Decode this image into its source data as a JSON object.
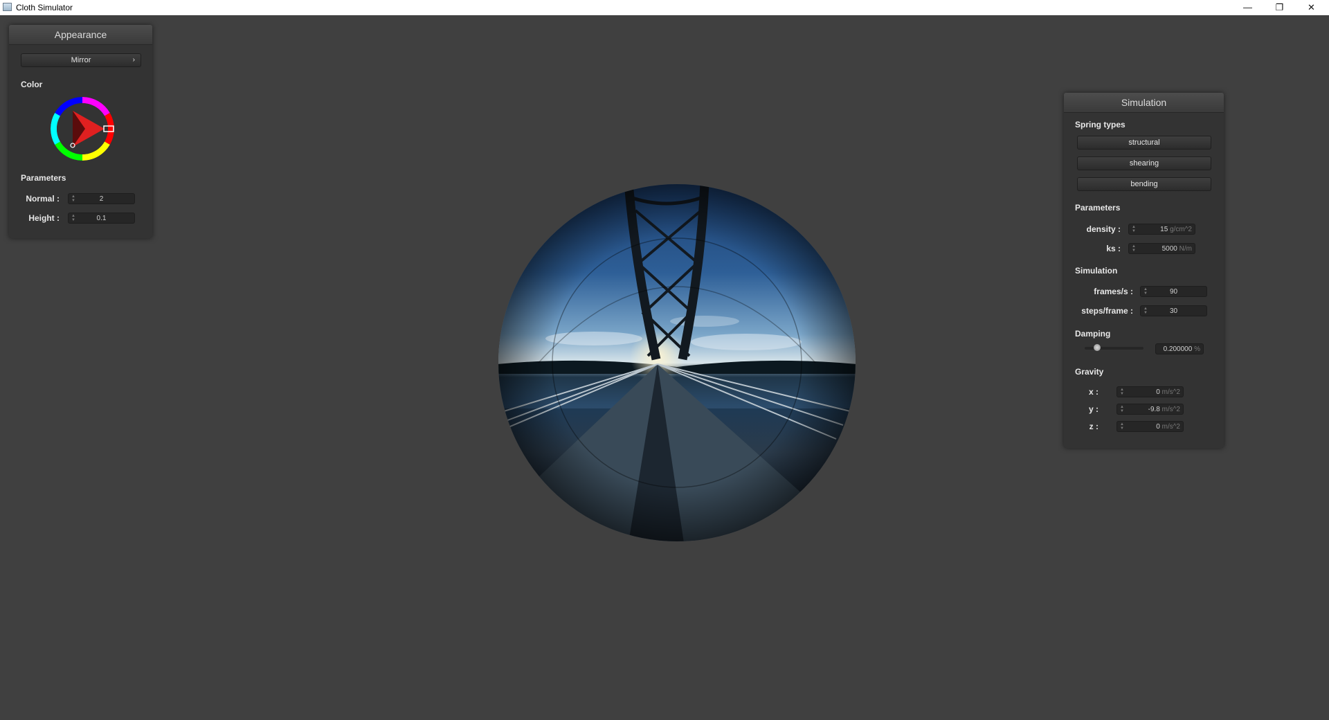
{
  "window": {
    "title": "Cloth Simulator",
    "minimize_icon": "minimize-icon",
    "restore_icon": "restore-icon",
    "close_icon": "close-icon"
  },
  "appearance": {
    "title": "Appearance",
    "shader_dropdown": "Mirror",
    "color_label": "Color",
    "color_value": "#e02020",
    "parameters_label": "Parameters",
    "normal_label": "Normal :",
    "normal_value": "2",
    "height_label": "Height :",
    "height_value": "0.1"
  },
  "simulation": {
    "title": "Simulation",
    "spring_types_label": "Spring types",
    "spring_buttons": [
      "structural",
      "shearing",
      "bending"
    ],
    "parameters_label": "Parameters",
    "density_label": "density :",
    "density_value": "15",
    "density_unit": "g/cm^2",
    "ks_label": "ks :",
    "ks_value": "5000",
    "ks_unit": "N/m",
    "simulation_label": "Simulation",
    "fps_label": "frames/s :",
    "fps_value": "90",
    "steps_label": "steps/frame :",
    "steps_value": "30",
    "damping_label": "Damping",
    "damping_value": "0.200000",
    "damping_unit": "%",
    "damping_slider_fraction": 0.2,
    "gravity_label": "Gravity",
    "gx_label": "x :",
    "gx_value": "0",
    "gy_label": "y :",
    "gy_value": "-9.8",
    "gz_label": "z :",
    "gz_value": "0",
    "gravity_unit": "m/s^2"
  },
  "scene": {
    "object": "mirror-sphere",
    "environment": "bridge-panorama"
  }
}
